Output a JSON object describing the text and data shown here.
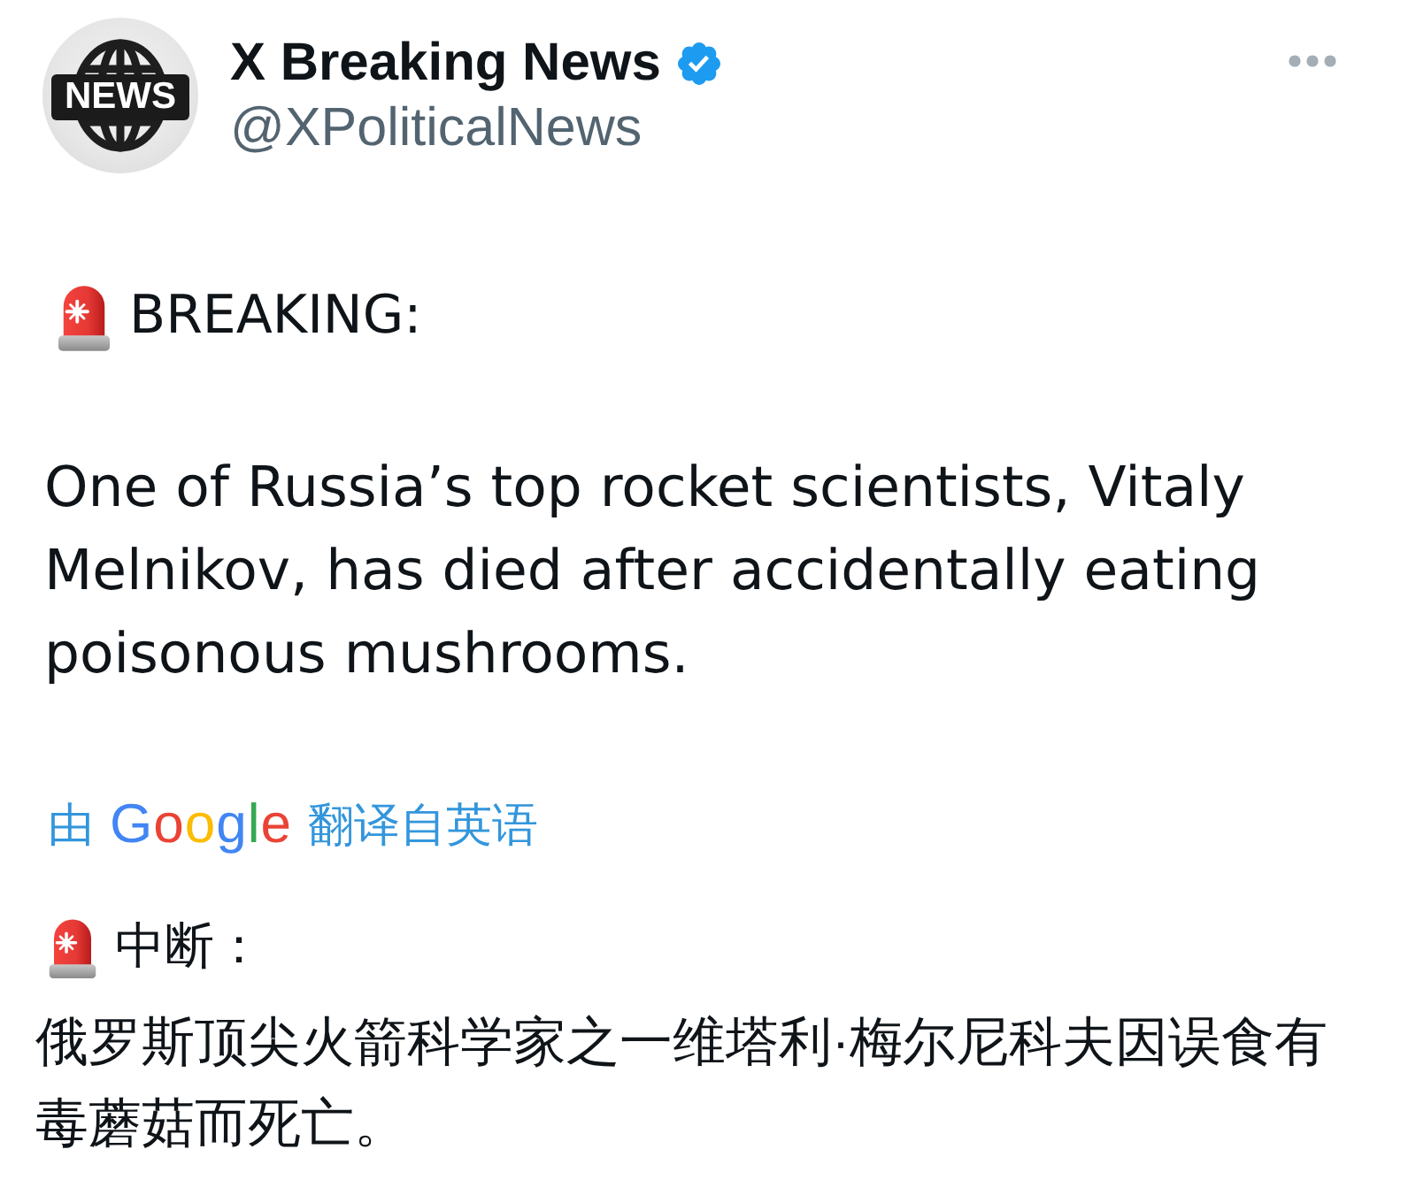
{
  "author": {
    "avatar_label": "NEWS",
    "name": "X Breaking News",
    "verified": true,
    "handle": "@XPoliticalNews"
  },
  "tweet": {
    "heading": "BREAKING:",
    "body": "One of Russia’s top rocket scientists, Vitaly Melnikov, has died after accidentally eating poisonous mushrooms."
  },
  "translation": {
    "prefix": "由",
    "service": "Google",
    "suffix": "翻译自英语",
    "heading": "中断：",
    "body": "俄罗斯顶尖火箭科学家之一维塔利·梅尔尼科夫因误食有毒蘑菇而死亡。"
  }
}
